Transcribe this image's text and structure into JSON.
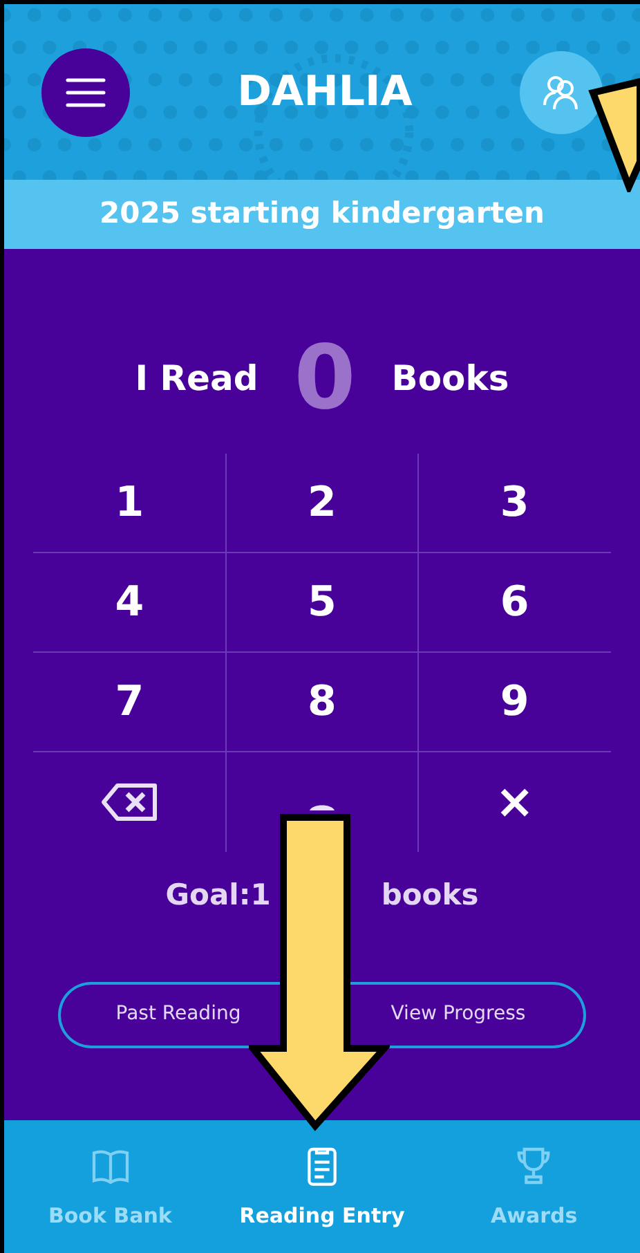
{
  "header": {
    "title": "DAHLIA"
  },
  "banner": "2025 starting kindergarten",
  "counter": {
    "prefix": "I Read",
    "count": "0",
    "suffix": "Books"
  },
  "keypad": [
    {
      "kind": "digit",
      "label": "1"
    },
    {
      "kind": "digit",
      "label": "2"
    },
    {
      "kind": "digit",
      "label": "3"
    },
    {
      "kind": "digit",
      "label": "4"
    },
    {
      "kind": "digit",
      "label": "5"
    },
    {
      "kind": "digit",
      "label": "6"
    },
    {
      "kind": "digit",
      "label": "7"
    },
    {
      "kind": "digit",
      "label": "8"
    },
    {
      "kind": "digit",
      "label": "9"
    },
    {
      "kind": "backspace"
    },
    {
      "kind": "hidden"
    },
    {
      "kind": "clear",
      "label": "×"
    }
  ],
  "goal": {
    "start": "Goal:1",
    "end": "books"
  },
  "buttons": [
    "Past Reading",
    "View Progress"
  ],
  "tabs": [
    {
      "label": "Book Bank",
      "selected": false
    },
    {
      "label": "Reading Entry",
      "selected": true
    },
    {
      "label": "Awards",
      "selected": false
    }
  ]
}
